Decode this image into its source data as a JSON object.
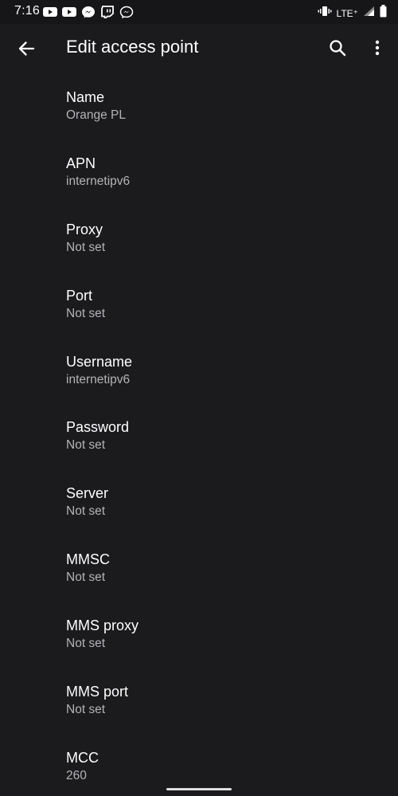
{
  "status_bar": {
    "time": "7:16",
    "notification_icons": [
      "youtube-icon",
      "youtube-icon",
      "messenger-icon",
      "twitch-icon",
      "messenger-icon"
    ],
    "network": "LTE⁺",
    "system_icons": [
      "vibrate-icon",
      "signal-icon",
      "battery-icon"
    ]
  },
  "app_bar": {
    "title": "Edit access point",
    "back_icon": "arrow-back-icon",
    "search_icon": "search-icon",
    "more_icon": "more-vert-icon"
  },
  "preferences": [
    {
      "title": "Name",
      "summary": "Orange PL"
    },
    {
      "title": "APN",
      "summary": "internetipv6"
    },
    {
      "title": "Proxy",
      "summary": "Not set"
    },
    {
      "title": "Port",
      "summary": "Not set"
    },
    {
      "title": "Username",
      "summary": "internetipv6"
    },
    {
      "title": "Password",
      "summary": "Not set"
    },
    {
      "title": "Server",
      "summary": "Not set"
    },
    {
      "title": "MMSC",
      "summary": "Not set"
    },
    {
      "title": "MMS proxy",
      "summary": "Not set"
    },
    {
      "title": "MMS port",
      "summary": "Not set"
    },
    {
      "title": "MCC",
      "summary": "260"
    }
  ],
  "theme": {
    "background": "#1b1b1d",
    "text_primary": "#ffffff",
    "text_secondary": "#b4b4b8"
  }
}
